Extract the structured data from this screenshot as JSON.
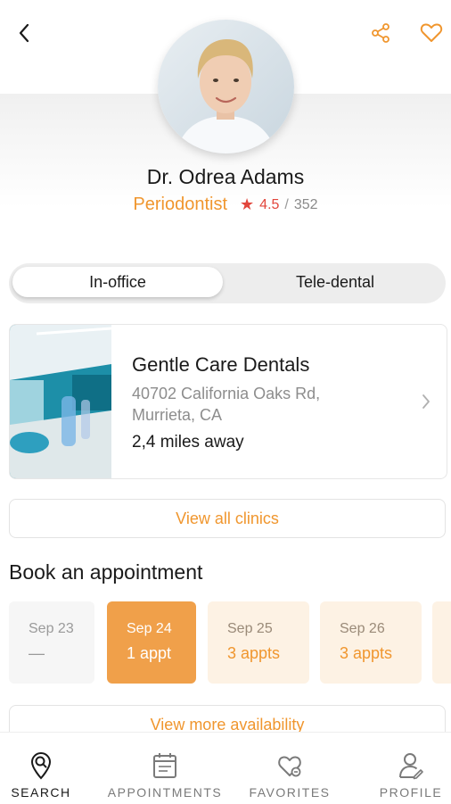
{
  "header": {
    "back_icon": "chevron-left-icon",
    "share_icon": "share-icon",
    "favorite_icon": "heart-icon"
  },
  "doctor": {
    "name": "Dr. Odrea Adams",
    "specialty": "Periodontist",
    "rating": "4.5",
    "reviews": "352"
  },
  "visit_type": {
    "options": [
      "In-office",
      "Tele-dental"
    ],
    "selected": "In-office"
  },
  "clinic": {
    "name": "Gentle Care Dentals",
    "address_line1": "40702 California Oaks Rd,",
    "address_line2": "Murrieta, CA",
    "distance": "2,4 miles away"
  },
  "view_all_clinics_label": "View all clinics",
  "booking": {
    "title": "Book an appointment",
    "dates": [
      {
        "date": "Sep 23",
        "availability": "—",
        "state": "none"
      },
      {
        "date": "Sep 24",
        "availability": "1 appt",
        "state": "selected"
      },
      {
        "date": "Sep 25",
        "availability": "3 appts",
        "state": "available"
      },
      {
        "date": "Sep 26",
        "availability": "3 appts",
        "state": "available"
      }
    ],
    "view_more_label": "View more availability"
  },
  "nav": {
    "items": [
      {
        "label": "SEARCH",
        "icon": "search-location-icon",
        "active": true
      },
      {
        "label": "APPOINTMENTS",
        "icon": "calendar-icon",
        "active": false
      },
      {
        "label": "FAVORITES",
        "icon": "heart-icon",
        "active": false
      },
      {
        "label": "PROFILE",
        "icon": "user-icon",
        "active": false
      }
    ]
  },
  "colors": {
    "accent": "#f0962e",
    "rating": "#e2463c",
    "selected_date": "#f0a04a",
    "available_date": "#fdf2e4"
  }
}
